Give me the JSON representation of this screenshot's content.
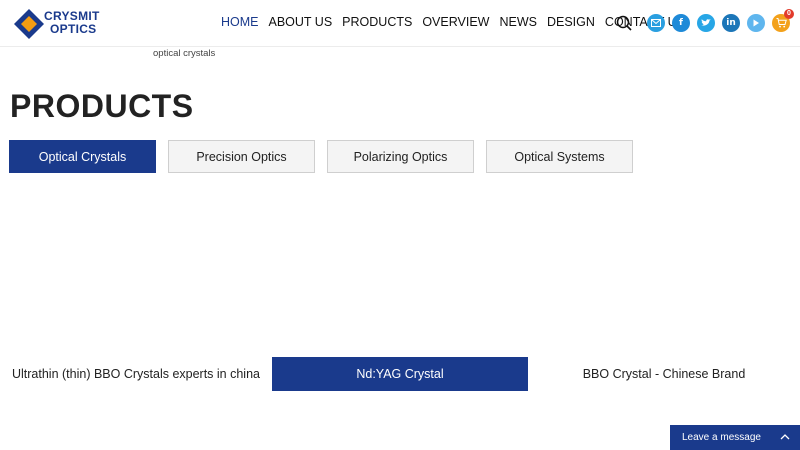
{
  "brand": {
    "line1": "CRYSMIT",
    "line2": "OPTICS",
    "colors": {
      "primary": "#1a3a8c",
      "accent": "#f39c12"
    }
  },
  "nav": {
    "items": [
      {
        "label": "HOME",
        "active": true
      },
      {
        "label": "ABOUT US"
      },
      {
        "label": "PRODUCTS"
      },
      {
        "label": "OVERVIEW"
      },
      {
        "label": "NEWS"
      },
      {
        "label": "DESIGN"
      },
      {
        "label": "CONTACT US"
      }
    ]
  },
  "header_icons": {
    "search": "search-icon",
    "socials": [
      "mail-icon",
      "facebook-icon",
      "twitter-icon",
      "linkedin-icon",
      "youtube-icon",
      "cart-icon"
    ],
    "cart_count": "0"
  },
  "breadcrumb": "optical crystals",
  "page_title": "PRODUCTS",
  "tabs": [
    {
      "label": "Optical Crystals",
      "active": true
    },
    {
      "label": "Precision Optics"
    },
    {
      "label": "Polarizing Optics"
    },
    {
      "label": "Optical Systems"
    }
  ],
  "products": [
    {
      "label": "Ultrathin (thin) BBO Crystals experts in china"
    },
    {
      "label": "Nd:YAG Crystal",
      "active": true
    },
    {
      "label": "BBO Crystal - Chinese Brand"
    }
  ],
  "leave_message": "Leave a message"
}
